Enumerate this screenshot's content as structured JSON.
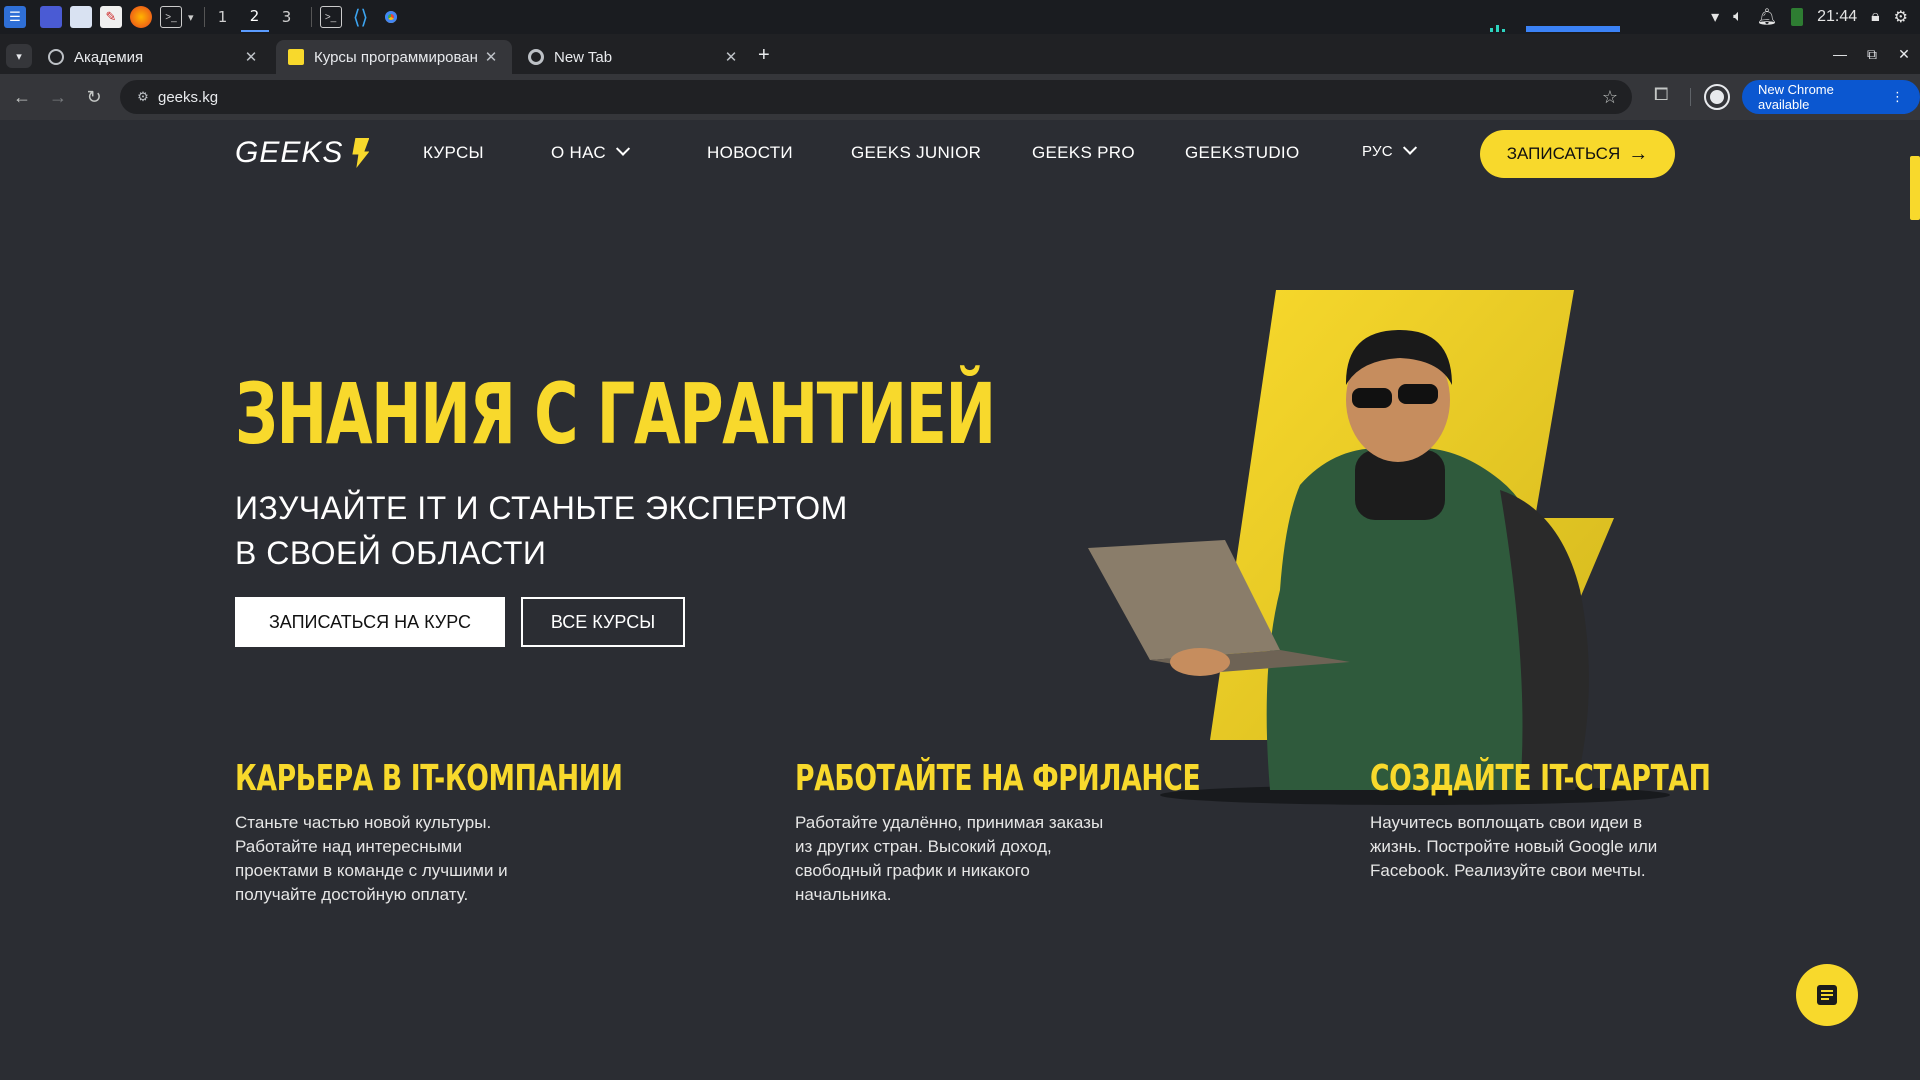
{
  "taskbar": {
    "workspaces": [
      "1",
      "2",
      "3"
    ],
    "clock": "21:44"
  },
  "browser": {
    "tabs": [
      {
        "title": "Академия"
      },
      {
        "title": "Курсы программирован"
      },
      {
        "title": "New Tab"
      }
    ],
    "new_tab": "+",
    "url": "geeks.kg",
    "update_label": "New Chrome available"
  },
  "site": {
    "logo": "GEEKS",
    "nav": [
      "КУРСЫ",
      "О НАС",
      "НОВОСТИ",
      "GEEKS JUNIOR",
      "GEEKS PRO",
      "GEEKSTUDIO",
      "РУС"
    ],
    "header_cta": "ЗАПИСАТЬСЯ",
    "hero_title": "ЗНАНИЯ С ГАРАНТИЕЙ",
    "hero_subtitle_line1": "ИЗУЧАЙТЕ IT И СТАНЬТЕ ЭКСПЕРТОМ",
    "hero_subtitle_line2": "В СВОЕЙ ОБЛАСТИ",
    "btn_enroll": "ЗАПИСАТЬСЯ НА КУРС",
    "btn_all_courses": "ВСЕ КУРСЫ",
    "features": [
      {
        "title": "КАРЬЕРА В IT-КОМПАНИИ",
        "text": "Станьте частью новой культуры. Работайте над интересными проектами в команде с лучшими и получайте достойную оплату."
      },
      {
        "title": "РАБОТАЙТЕ НА ФРИЛАНСЕ",
        "text": "Работайте удалённо, принимая заказы из других стран. Высокий доход, свободный график и никакого начальника."
      },
      {
        "title": "СОЗДАЙТЕ IT-СТАРТАП",
        "text": "Научитесь воплощать свои идеи в жизнь. Постройте новый Google или Facebook. Реализуйте свои мечты."
      }
    ]
  },
  "colors": {
    "accent": "#f8d92c",
    "page_bg": "#2b2d33"
  }
}
